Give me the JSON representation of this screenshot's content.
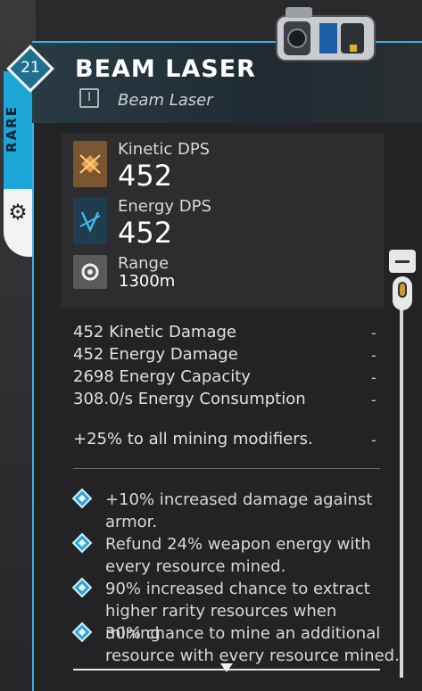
{
  "item": {
    "level": "21",
    "name": "BEAM LASER",
    "type_icon": "roman-numeral-one-icon",
    "type_icon_text": "I",
    "subtitle": "Beam Laser",
    "rarity": "RARE"
  },
  "stats": [
    {
      "label": "Kinetic DPS",
      "value": "452",
      "icon": "kinetic-dps-icon"
    },
    {
      "label": "Energy DPS",
      "value": "452",
      "icon": "energy-dps-icon"
    },
    {
      "label": "Range",
      "value": "1300m",
      "icon": "range-icon"
    }
  ],
  "attributes": [
    {
      "text": "452 Kinetic Damage",
      "dash": "-"
    },
    {
      "text": "452 Energy Damage",
      "dash": "-"
    },
    {
      "text": "2698 Energy Capacity",
      "dash": "-"
    },
    {
      "text": "308.0/s Energy Consumption",
      "dash": "-"
    }
  ],
  "bonus": {
    "text": "+25% to all mining modifiers.",
    "dash": "-"
  },
  "perks": [
    {
      "text": "+10% increased damage against armor."
    },
    {
      "text": "Refund 24% weapon energy with every resource mined."
    },
    {
      "text": "90% increased chance to extract higher rarity resources when mining."
    },
    {
      "text": "30% chance to mine an additional resource with every resource mined."
    }
  ],
  "colors": {
    "accent": "#2fb7e8",
    "rarity": "#1da6d8",
    "kinetic": "#7a5532",
    "energy": "#1f3d4f"
  }
}
